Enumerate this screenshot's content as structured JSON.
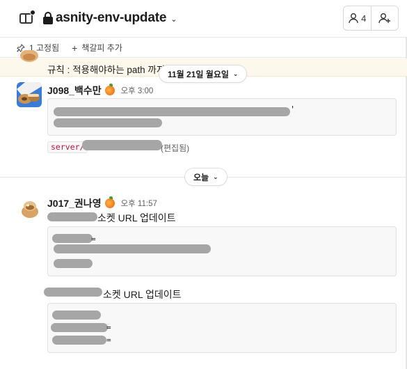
{
  "header": {
    "channel_name": "asnity-env-update",
    "member_count": "4",
    "icons": [
      "panel-toggle-icon",
      "lock-icon",
      "chevron-down-icon",
      "person-icon",
      "add-person-icon"
    ]
  },
  "pinbar": {
    "pinned_label": "1 고정됨",
    "add_bookmark_label": "책갈피 추가"
  },
  "banner": {
    "text": "규칙 : 적용해야하는 path 까지 공유"
  },
  "date_dividers": [
    {
      "label": "11월 21일 월요일"
    },
    {
      "label": "오늘"
    }
  ],
  "messages": [
    {
      "author": "J098_백수만",
      "time": "오후 3:00",
      "code_suffix": "'",
      "inline_code": "server/",
      "edited": "(편집됨)"
    },
    {
      "author": "J017_권나영",
      "time": "오후 11:57",
      "text_1": "소켓 URL 업데이트",
      "code_1_suffix": "=",
      "text_2": "소켓 URL 업데이트",
      "code_2_suffix_a": "=",
      "code_2_suffix_b": "="
    }
  ],
  "colors": {
    "code_text": "#c01343",
    "banner_bg": "#fdf8ec",
    "redaction": "#a6a6a6"
  }
}
